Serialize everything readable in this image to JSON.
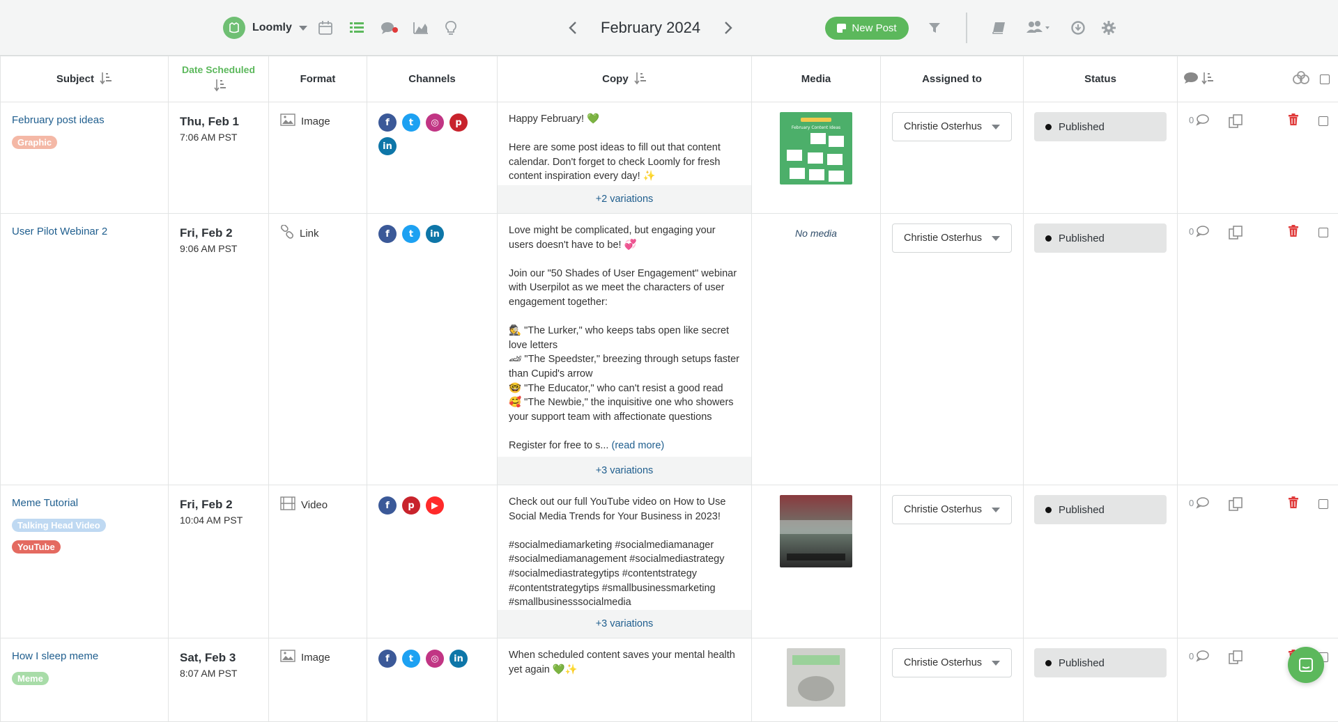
{
  "toolbar": {
    "brand_name": "Loomly",
    "month": "February 2024",
    "new_post_label": "New Post"
  },
  "columns": {
    "subject": "Subject",
    "date": "Date Scheduled",
    "format": "Format",
    "channels": "Channels",
    "copy": "Copy",
    "media": "Media",
    "assigned": "Assigned to",
    "status": "Status"
  },
  "colors": {
    "brand_green": "#5cb85c",
    "link_blue": "#1f5e8e",
    "delete_red": "#e03a3a",
    "facebook": "#3b5998",
    "twitter": "#1da1f2",
    "instagram": "#c13584",
    "pinterest": "#c8232c",
    "linkedin": "#0e76a8",
    "youtube": "#ff2a2a"
  },
  "rows": [
    {
      "subject": "February post ideas",
      "tags": [
        {
          "label": "Graphic",
          "color": "#f4b8a6"
        }
      ],
      "date": "Thu, Feb 1",
      "time": "7:06 AM PST",
      "format": "Image",
      "format_icon": "image-icon",
      "channels": [
        "facebook",
        "twitter",
        "instagram",
        "pinterest",
        "linkedin"
      ],
      "copy": "Happy February! 💚\n\nHere are some post ideas to fill out that content calendar. Don't forget to check Loomly for fresh content inspiration every day! ✨",
      "read_more": "",
      "variations": "+2 variations",
      "media": "February Content Ideas",
      "assigned": "Christie Osterhus",
      "status": "Published",
      "comment_count": "0"
    },
    {
      "subject": "User Pilot Webinar 2",
      "tags": [],
      "date": "Fri, Feb 2",
      "time": "9:06 AM PST",
      "format": "Link",
      "format_icon": "link-icon",
      "channels": [
        "facebook",
        "twitter",
        "linkedin"
      ],
      "copy": "Love might be complicated, but engaging your users doesn't have to be! 💞\n\nJoin our \"50 Shades of User Engagement\" webinar with Userpilot as we meet the characters of user engagement together:\n\n🕵 \"The Lurker,\" who keeps tabs open like secret love letters\n🏎 \"The Speedster,\" breezing through setups faster than Cupid's arrow\n🤓 \"The Educator,\" who can't resist a good read\n🥰 \"The Newbie,\" the inquisitive one who showers your support team with affectionate questions\n\nRegister for free to s... ",
      "read_more": "(read more)",
      "variations": "+3 variations",
      "media": "No media",
      "assigned": "Christie Osterhus",
      "status": "Published",
      "comment_count": "0"
    },
    {
      "subject": "Meme Tutorial",
      "tags": [
        {
          "label": "Talking Head Video",
          "color": "#bfd9f2"
        },
        {
          "label": "YouTube",
          "color": "#e46a60"
        }
      ],
      "date": "Fri, Feb 2",
      "time": "10:04 AM PST",
      "format": "Video",
      "format_icon": "video-icon",
      "channels": [
        "facebook",
        "pinterest",
        "youtube"
      ],
      "copy": "Check out our full YouTube video on How to Use Social Media Trends for Your Business in 2023!\n\n#socialmediamarketing #socialmediamanager #socialmediamanagement #socialmediastrategy #socialmediastrategytips #contentstrategy #contentstrategytips #smallbusinessmarketing #smallbusinesssocialmedia",
      "read_more": "",
      "variations": "+3 variations",
      "media": "video thumbnail",
      "assigned": "Christie Osterhus",
      "status": "Published",
      "comment_count": "0"
    },
    {
      "subject": "How I sleep meme",
      "tags": [
        {
          "label": "Meme",
          "color": "#a8dca8"
        }
      ],
      "date": "Sat, Feb 3",
      "time": "8:07 AM PST",
      "format": "Image",
      "format_icon": "image-icon",
      "channels": [
        "facebook",
        "twitter",
        "instagram",
        "linkedin"
      ],
      "copy": "When scheduled content saves your mental health yet again 💚✨",
      "read_more": "",
      "variations": "",
      "media": "meme image",
      "assigned": "Christie Osterhus",
      "status": "Published",
      "comment_count": "0"
    }
  ]
}
